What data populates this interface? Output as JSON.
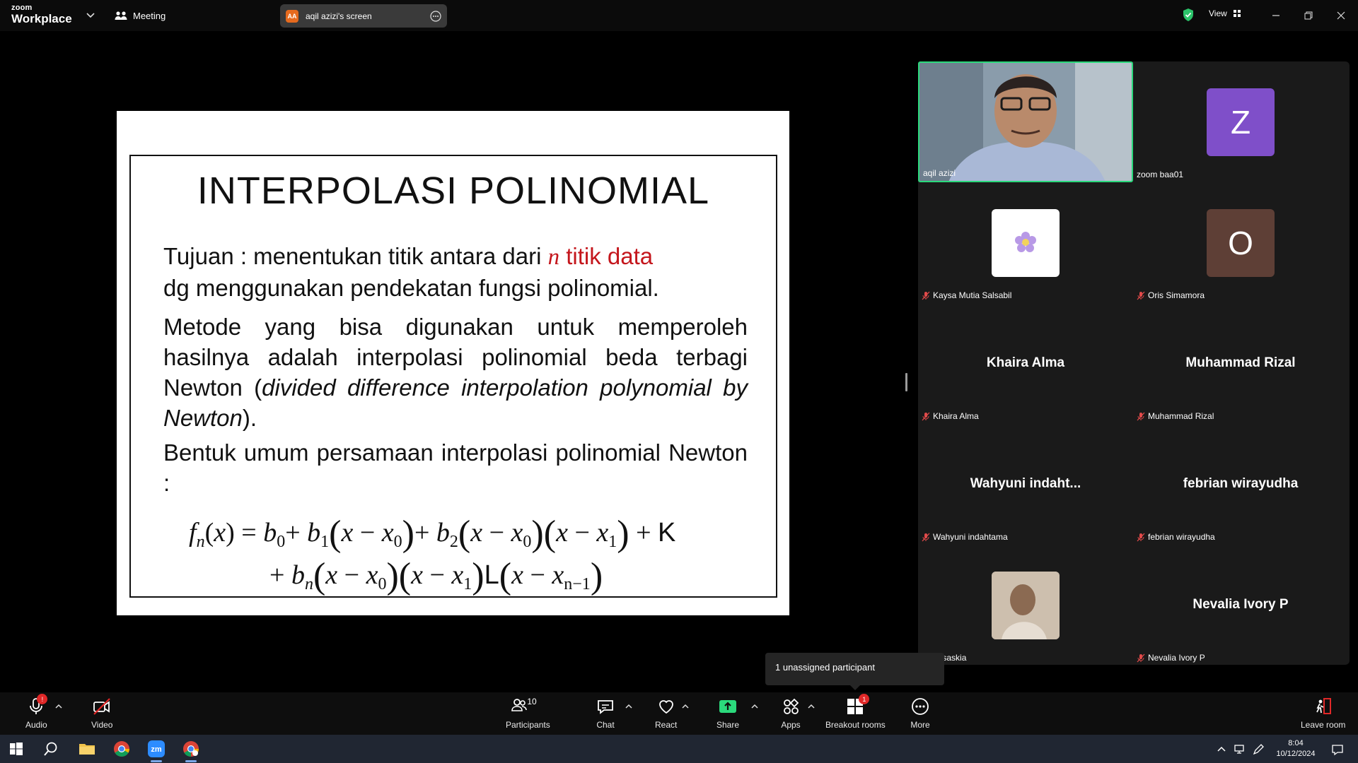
{
  "topbar": {
    "logo_line1": "zoom",
    "logo_line2": "Workplace",
    "meeting_label": "Meeting",
    "share_initials": "AA",
    "share_label": "aqil azizi's screen",
    "view_label": "View"
  },
  "slide": {
    "title": "INTERPOLASI  POLINOMIAL",
    "p1_a": "Tujuan : menentukan titik antara dari ",
    "p1_n": "n",
    "p1_b": " titik data",
    "p1_c": "dg menggunakan pendekatan fungsi polinomial.",
    "p2_a": "Metode yang bisa digunakan untuk memperoleh hasilnya adalah interpolasi polinomial beda terbagi Newton (",
    "p2_it": "divided difference interpolation polynomial by Newton",
    "p2_b": ").",
    "p3": "Bentuk umum persamaan interpolasi polinomial Newton :"
  },
  "gallery": {
    "tiles": [
      {
        "name": "aqil azizi"
      },
      {
        "name": "zoom baa01",
        "initial": "Z",
        "color": "#7f4fc9"
      },
      {
        "name": "Kaysa Mutia Salsabil"
      },
      {
        "name": "Oris Simamora",
        "initial": "O",
        "color": "#5e3f36"
      },
      {
        "name": "Khaira Alma",
        "display": "Khaira Alma"
      },
      {
        "name": "Muhammad Rizal",
        "display": "Muhammad Rizal"
      },
      {
        "name": "Wahyuni indahtama",
        "display": "Wahyuni  indaht..."
      },
      {
        "name": "febrian wirayudha",
        "display": "febrian wirayudha"
      },
      {
        "name": "anka saskia"
      },
      {
        "name": "Nevalia Ivory P",
        "display": "Nevalia Ivory P"
      }
    ]
  },
  "tooltip": "1 unassigned participant",
  "toolbar": {
    "audio": "Audio",
    "video": "Video",
    "participants": "Participants",
    "participants_count": "10",
    "chat": "Chat",
    "react": "React",
    "share": "Share",
    "apps": "Apps",
    "breakout": "Breakout rooms",
    "breakout_badge": "1",
    "more": "More",
    "leave": "Leave room",
    "audio_badge": "!"
  },
  "taskbar": {
    "time": "8:04",
    "date": "10/12/2024"
  },
  "colors": {
    "accent_green": "#2bd97c",
    "share_green": "#2bd97c",
    "alert_red": "#e02828"
  }
}
